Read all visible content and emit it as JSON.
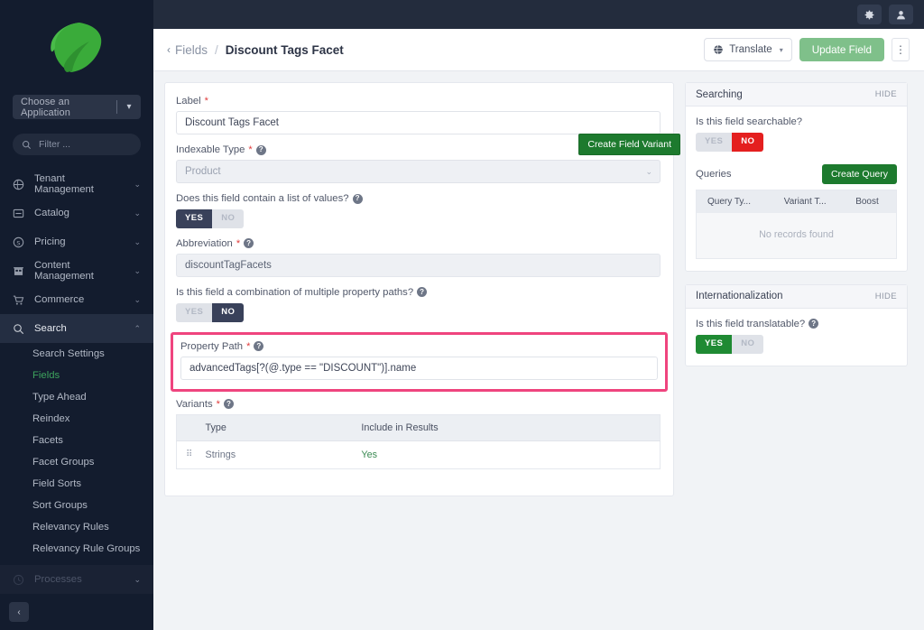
{
  "sidebar": {
    "logo_icon": "leaf-logo",
    "app_select": {
      "label": "Choose an Application",
      "chevron": "▾"
    },
    "filter": {
      "placeholder": "Filter ...",
      "icon": "search-icon"
    },
    "nav": [
      {
        "label": "Tenant Management",
        "icon": "globe-icon",
        "caret": "⌄",
        "state": "normal"
      },
      {
        "label": "Catalog",
        "icon": "box-icon",
        "caret": "⌄",
        "state": "normal"
      },
      {
        "label": "Pricing",
        "icon": "dollar-icon",
        "caret": "⌄",
        "state": "normal"
      },
      {
        "label": "Content Management",
        "icon": "building-icon",
        "caret": "⌄",
        "state": "normal"
      },
      {
        "label": "Commerce",
        "icon": "cart-icon",
        "caret": "⌄",
        "state": "normal"
      },
      {
        "label": "Search",
        "icon": "search-icon",
        "caret": "⌃",
        "state": "active"
      }
    ],
    "sub_items": [
      {
        "label": "Search Settings",
        "selected": false
      },
      {
        "label": "Fields",
        "selected": true
      },
      {
        "label": "Type Ahead",
        "selected": false
      },
      {
        "label": "Reindex",
        "selected": false
      },
      {
        "label": "Facets",
        "selected": false
      },
      {
        "label": "Facet Groups",
        "selected": false
      },
      {
        "label": "Field Sorts",
        "selected": false
      },
      {
        "label": "Sort Groups",
        "selected": false
      },
      {
        "label": "Relevancy Rules",
        "selected": false
      },
      {
        "label": "Relevancy Rule Groups",
        "selected": false
      }
    ],
    "dim_item": {
      "label": "Processes",
      "icon": "clock-icon",
      "caret": "⌄"
    },
    "collapse": {
      "label": "‹",
      "name": "collapse-sidebar-button"
    }
  },
  "topbar": {
    "settings_icon": "gear-icon",
    "account_icon": "user-icon"
  },
  "header": {
    "back_icon": "‹",
    "parent": "Fields",
    "separator": "/",
    "current": "Discount Tags Facet",
    "translate_label": "Translate",
    "translate_icon": "globe-icon",
    "translate_caret": "▾",
    "update_label": "Update Field",
    "kebab": "⋮"
  },
  "form": {
    "label_field": {
      "label": "Label",
      "required": "*",
      "value": "Discount Tags Facet"
    },
    "indexable_type": {
      "label": "Indexable Type",
      "required": "*",
      "help": "?",
      "value": "Product",
      "caret": "⌄"
    },
    "list_of_values": {
      "label": "Does this field contain a list of values?",
      "help": "?",
      "yes": "YES",
      "no": "NO",
      "selected": "YES"
    },
    "abbreviation": {
      "label": "Abbreviation",
      "required": "*",
      "help": "?",
      "value": "discountTagFacets"
    },
    "combination": {
      "label": "Is this field a combination of multiple property paths?",
      "help": "?",
      "yes": "YES",
      "no": "NO",
      "selected": "NO"
    },
    "property_path": {
      "label": "Property Path",
      "required": "*",
      "help": "?",
      "value": "advancedTags[?(@.type == \"DISCOUNT\")].name",
      "highlight_color": "#ef447e"
    },
    "create_field_variant": "Create Field Variant",
    "variants": {
      "label": "Variants",
      "required": "*",
      "help": "?",
      "columns": [
        "Type",
        "Include in Results"
      ],
      "rows": [
        {
          "grip": "⠿",
          "type": "Strings",
          "include": "Yes"
        }
      ]
    }
  },
  "searching_panel": {
    "title": "Searching",
    "hide": "HIDE",
    "question": "Is this field searchable?",
    "yes": "YES",
    "no": "NO",
    "selected": "NO",
    "queries_label": "Queries",
    "create_query": "Create Query",
    "columns": [
      "Query Ty...",
      "Variant T...",
      "Boost"
    ],
    "empty_text": "No records found"
  },
  "i18n_panel": {
    "title": "Internationalization",
    "hide": "HIDE",
    "question": "Is this field translatable?",
    "help": "?",
    "yes": "YES",
    "no": "NO",
    "selected": "YES"
  }
}
